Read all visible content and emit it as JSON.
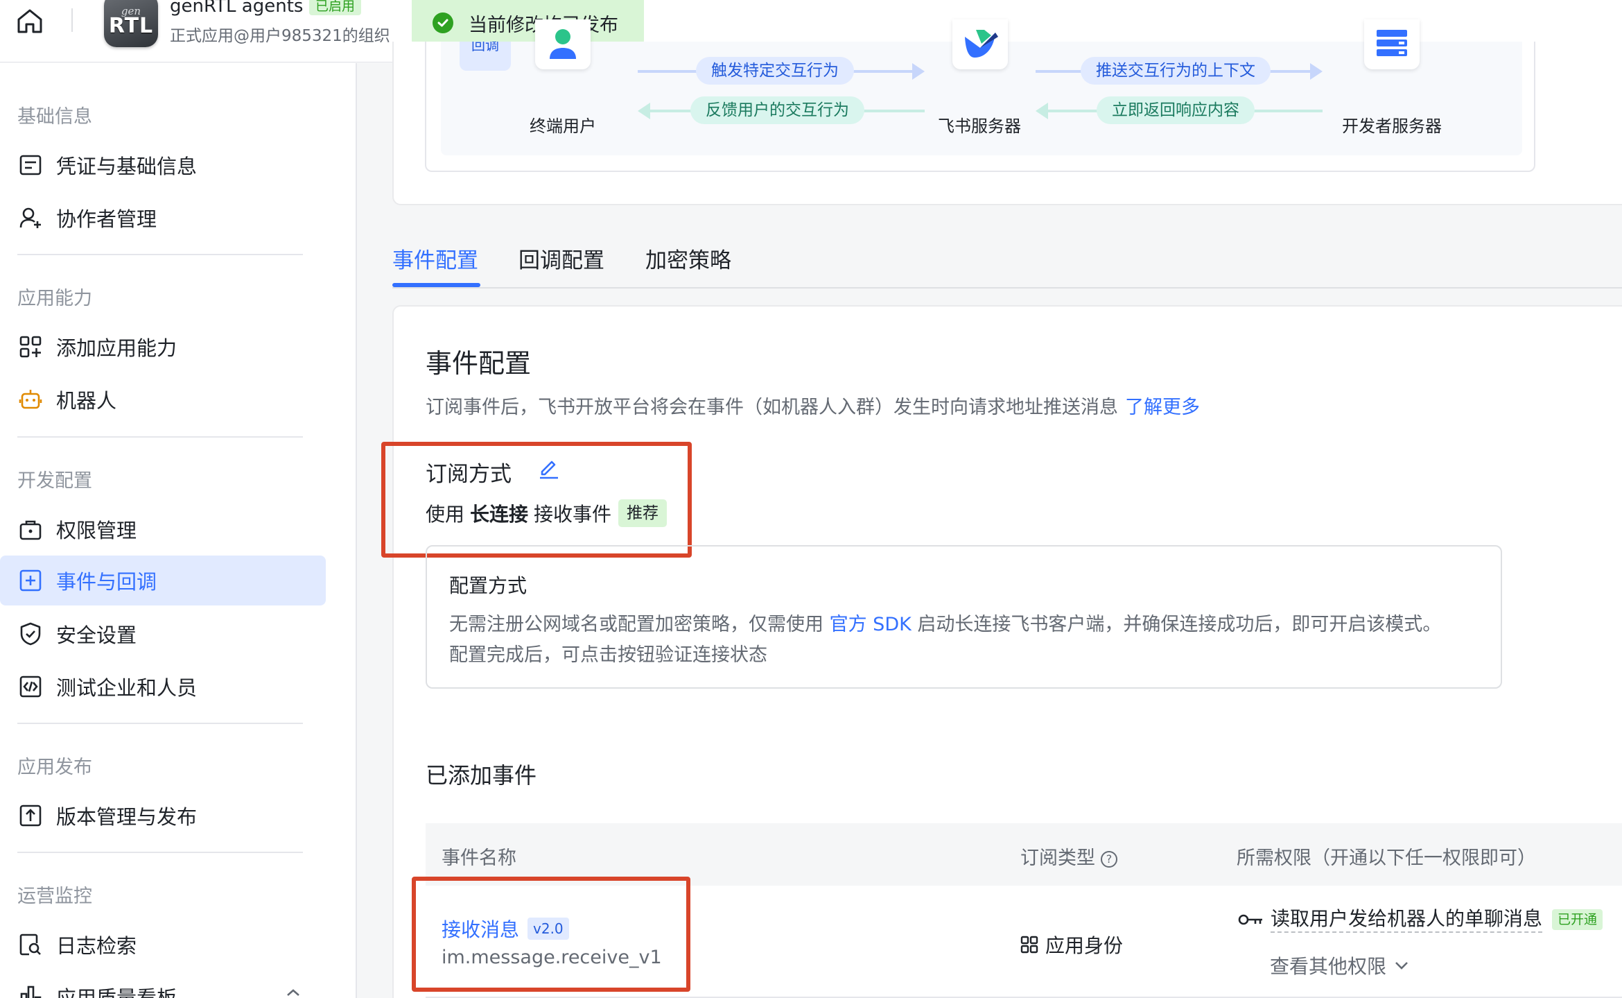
{
  "header": {
    "app_name": "genRTL agents",
    "app_status": "已启用",
    "app_org": "正式应用@用户985321的组织",
    "logo_small": "gen",
    "logo_big": "RTL",
    "publish_status": "当前修改均已发布"
  },
  "sidebar": {
    "sections": [
      {
        "title": "基础信息",
        "items": [
          {
            "label": "凭证与基础信息",
            "icon": "credential-icon"
          },
          {
            "label": "协作者管理",
            "icon": "add-user-icon"
          }
        ]
      },
      {
        "title": "应用能力",
        "items": [
          {
            "label": "添加应用能力",
            "icon": "apps-add-icon"
          },
          {
            "label": "机器人",
            "icon": "robot-icon"
          }
        ]
      },
      {
        "title": "开发配置",
        "items": [
          {
            "label": "权限管理",
            "icon": "permission-icon"
          },
          {
            "label": "事件与回调",
            "icon": "event-icon",
            "active": true
          },
          {
            "label": "安全设置",
            "icon": "shield-icon"
          },
          {
            "label": "测试企业和人员",
            "icon": "code-icon"
          }
        ]
      },
      {
        "title": "应用发布",
        "items": [
          {
            "label": "版本管理与发布",
            "icon": "upload-icon"
          }
        ]
      },
      {
        "title": "运营监控",
        "items": [
          {
            "label": "日志检索",
            "icon": "log-search-icon"
          },
          {
            "label": "应用质量看板",
            "icon": "chart-icon"
          }
        ]
      }
    ]
  },
  "diagram": {
    "cut_tag": "回调",
    "nodes": {
      "user": "终端用户",
      "feishu": "飞书服务器",
      "dev": "开发者服务器"
    },
    "flows": {
      "trigger": "触发特定交互行为",
      "feedback": "反馈用户的交互行为",
      "push_context": "推送交互行为的上下文",
      "return_resp": "立即返回响应内容"
    }
  },
  "tabs": [
    {
      "label": "事件配置",
      "active": true
    },
    {
      "label": "回调配置"
    },
    {
      "label": "加密策略"
    }
  ],
  "event_config": {
    "title": "事件配置",
    "desc": "订阅事件后，飞书开放平台将会在事件（如机器人入群）发生时向请求地址推送消息",
    "learn_more": "了解更多",
    "sub_title": "订阅方式",
    "method_prefix": "使用",
    "method_bold": "长连接",
    "method_suffix": "接收事件",
    "recommended": "推荐",
    "info": {
      "title": "配置方式",
      "line1_a": "无需注册公网域名或配置加密策略，仅需使用",
      "line1_link": "官方 SDK",
      "line1_b": "启动长连接飞书客户端，并确保连接成功后，即可开启该模式。",
      "line2": "配置完成后，可点击按钮验证连接状态"
    },
    "added_title": "已添加事件"
  },
  "table": {
    "headers": {
      "name": "事件名称",
      "type": "订阅类型",
      "perm": "所需权限（开通以下任一权限即可）"
    },
    "rows": [
      {
        "name": "接收消息",
        "version": "v2.0",
        "key": "im.message.receive_v1",
        "type": "应用身份",
        "perm": "读取用户发给机器人的单聊消息",
        "perm_status": "已开通",
        "more": "查看其他权限"
      }
    ]
  },
  "colors": {
    "accent": "#3370ff",
    "highlight": "#d8452a",
    "success": "#2ea121"
  }
}
